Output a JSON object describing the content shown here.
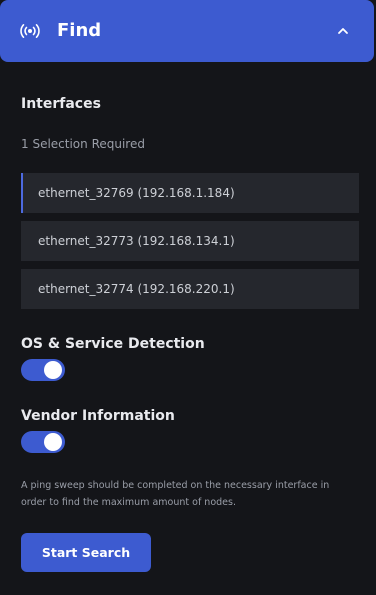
{
  "header": {
    "title": "Find",
    "icon": "broadcast-icon",
    "collapse_icon": "chevron-up-icon",
    "accent_color": "#3d5bd0"
  },
  "interfaces": {
    "title": "Interfaces",
    "subtitle": "1 Selection Required",
    "items": [
      {
        "label": "ethernet_32769 (192.168.1.184)",
        "selected": true
      },
      {
        "label": "ethernet_32773 (192.168.134.1)",
        "selected": false
      },
      {
        "label": "ethernet_32774 (192.168.220.1)",
        "selected": false
      }
    ]
  },
  "os_detection": {
    "label": "OS & Service Detection",
    "enabled": true
  },
  "vendor_info": {
    "label": "Vendor Information",
    "enabled": true
  },
  "note": "A ping sweep should be completed on the necessary interface in order to find the maximum amount of nodes.",
  "start_button": {
    "label": "Start Search"
  }
}
